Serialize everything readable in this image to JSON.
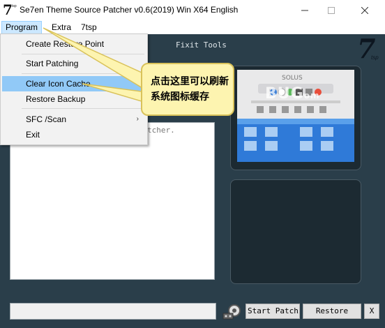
{
  "window": {
    "logo_main": "7",
    "logo_sub": "tsp",
    "title": "Se7en Theme Source Patcher v0.6(2019) Win X64 English"
  },
  "menubar": {
    "items": [
      "Program",
      "Extra",
      "7tsp"
    ]
  },
  "dropdown": {
    "items": [
      "Create Restore Point",
      "Start Patching",
      "Clear Icon Cache",
      "Restore Backup",
      "SFC /Scan",
      "Exit"
    ],
    "highlighted": "Clear Icon Cache",
    "submenu_arrow": "›"
  },
  "main": {
    "fixit_label": "Fixit Tools",
    "brand_logo": "7",
    "brand_logo_sub": "tsp",
    "status_text": "tcher.",
    "preview_title": "SOLUS",
    "watermark": "BUG",
    "watermark_suffix": "om"
  },
  "callout": {
    "text": "点击这里可以刷新系统图标缓存"
  },
  "bottom": {
    "path_value": "",
    "start_label": "Start Patching",
    "restore_label": "Restore",
    "x_label": "X"
  },
  "colors": {
    "main_bg": "#2a3e4a",
    "menu_highlight": "#91c9f7",
    "callout_bg": "#fdf4b0",
    "callout_border": "#d9c25a"
  }
}
